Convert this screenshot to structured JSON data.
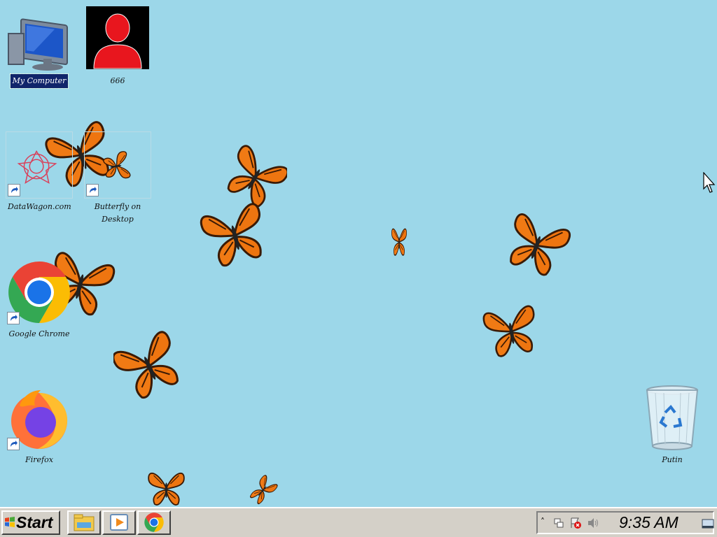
{
  "desktop": {
    "background_color": "#9cd7e9",
    "icons": [
      {
        "name": "my-computer",
        "label": "My Computer",
        "selected": true
      },
      {
        "name": "user-666",
        "label": "666"
      },
      {
        "name": "datawagon",
        "label": "DataWagon.com",
        "shortcut": true
      },
      {
        "name": "butterfly-on-desktop",
        "label": "Butterfly on\nDesktop",
        "shortcut": true
      },
      {
        "name": "google-chrome",
        "label": "Google Chrome",
        "shortcut": true
      },
      {
        "name": "firefox",
        "label": "Firefox",
        "shortcut": true
      },
      {
        "name": "recycle-bin",
        "label": "Putin"
      }
    ]
  },
  "taskbar": {
    "start_label": "Start",
    "quick_launch": [
      "file-explorer-icon",
      "media-player-icon",
      "chrome-icon"
    ],
    "tray_icons": [
      "show-hidden-icons-chevron",
      "network-icon",
      "action-center-flag-icon",
      "volume-icon",
      "show-desktop-icon"
    ],
    "clock": "9:35 AM"
  }
}
